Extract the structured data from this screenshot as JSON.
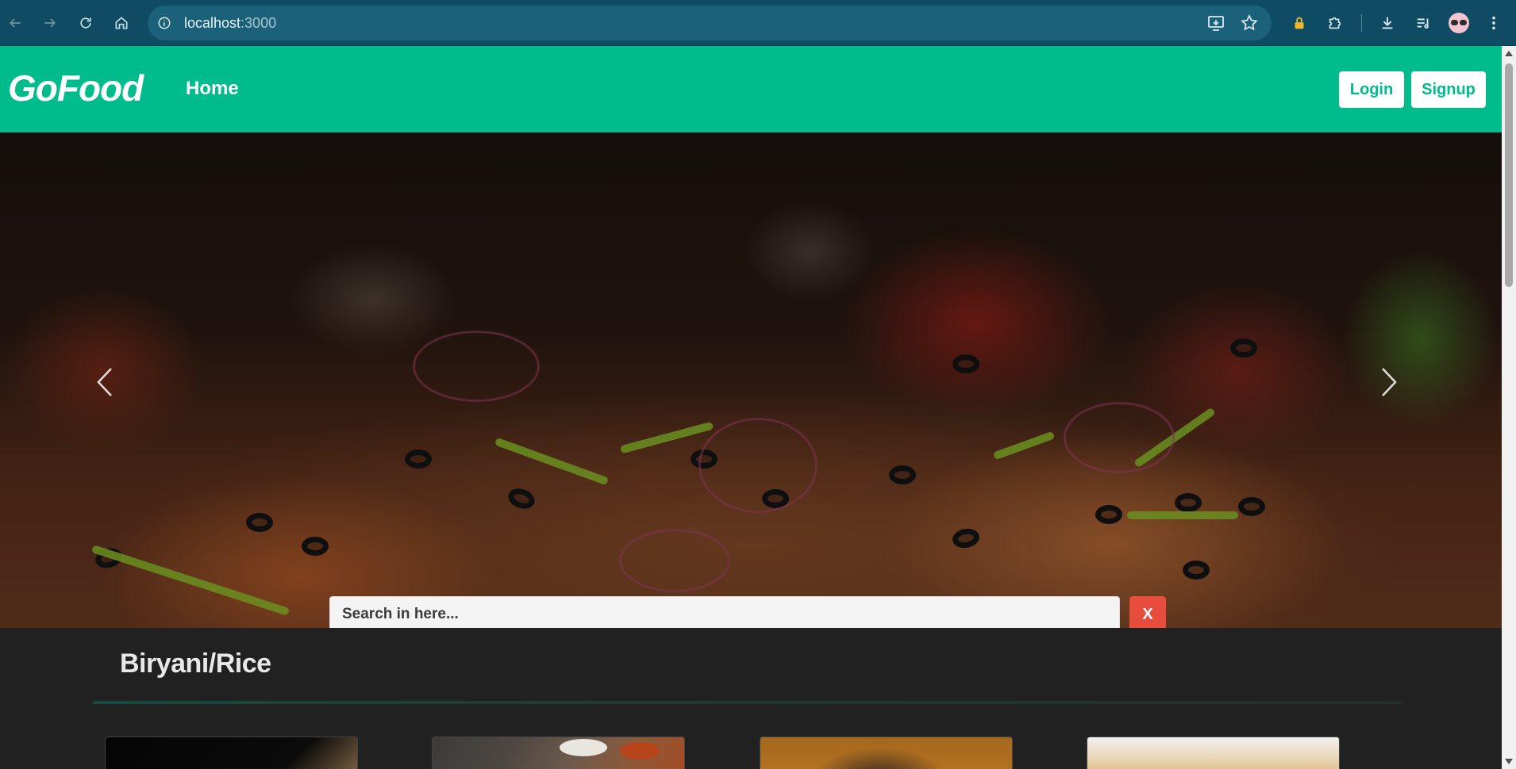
{
  "browser": {
    "url_host": "localhost",
    "url_port": ":3000",
    "icons": [
      "back-icon",
      "forward-icon",
      "reload-icon",
      "home-icon",
      "site-info-icon",
      "install-app-icon",
      "bookmark-star-icon",
      "extension-lock-icon",
      "extensions-puzzle-icon",
      "downloads-icon",
      "media-queue-icon",
      "profile-avatar",
      "more-menu-icon"
    ]
  },
  "navbar": {
    "brand": "GoFood",
    "home_label": "Home",
    "login_label": "Login",
    "signup_label": "Signup",
    "background_color": "#00bc8c"
  },
  "carousel": {
    "prev_icon": "chevron-left-icon",
    "next_icon": "chevron-right-icon"
  },
  "search": {
    "placeholder": "Search in here...",
    "value": "",
    "clear_label": "X",
    "clear_color": "#e74c3c"
  },
  "category": {
    "title": "Biryani/Rice"
  },
  "page": {
    "background_color": "#212121"
  }
}
